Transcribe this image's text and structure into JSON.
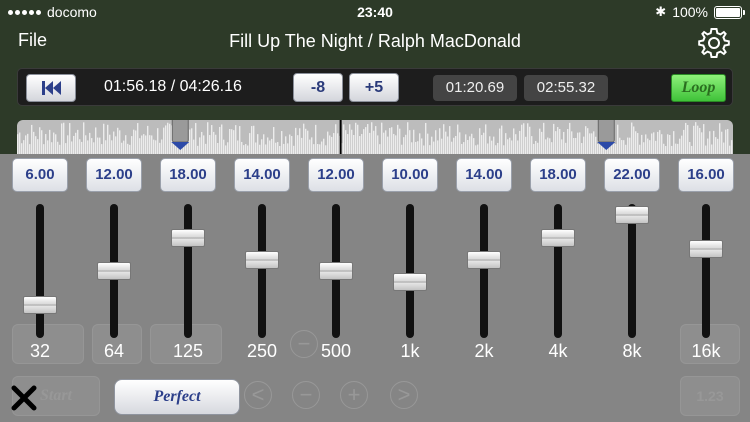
{
  "status_bar": {
    "carrier": "docomo",
    "time": "23:40",
    "battery": "100%",
    "battery_level": 1.0
  },
  "title_bar": {
    "file_label": "File",
    "title": "Fill Up The Night / Ralph MacDonald"
  },
  "transport": {
    "position": "01:56.18 / 04:26.16",
    "minus_label": "-8",
    "plus_label": "+5",
    "loop_start": "01:20.69",
    "loop_end": "02:55.32",
    "loop_label": "Loop"
  },
  "waveform": {
    "marker_a_fraction": 0.228,
    "marker_b_fraction": 0.823,
    "playhead_fraction": 0.452
  },
  "background": {
    "start_label": "Start",
    "rate_label": "1.23"
  },
  "equalizer": {
    "range_max": 24,
    "bands": [
      {
        "freq": "32",
        "gain": "6.00",
        "level": 6
      },
      {
        "freq": "64",
        "gain": "12.00",
        "level": 12
      },
      {
        "freq": "125",
        "gain": "18.00",
        "level": 18
      },
      {
        "freq": "250",
        "gain": "14.00",
        "level": 14
      },
      {
        "freq": "500",
        "gain": "12.00",
        "level": 12
      },
      {
        "freq": "1k",
        "gain": "10.00",
        "level": 10
      },
      {
        "freq": "2k",
        "gain": "14.00",
        "level": 14
      },
      {
        "freq": "4k",
        "gain": "18.00",
        "level": 18
      },
      {
        "freq": "8k",
        "gain": "22.00",
        "level": 22
      },
      {
        "freq": "16k",
        "gain": "16.00",
        "level": 16
      }
    ],
    "preset_label": "Perfect"
  },
  "colors": {
    "accent_blue": "#2c3f8a",
    "loop_green": "#4fd44a"
  }
}
